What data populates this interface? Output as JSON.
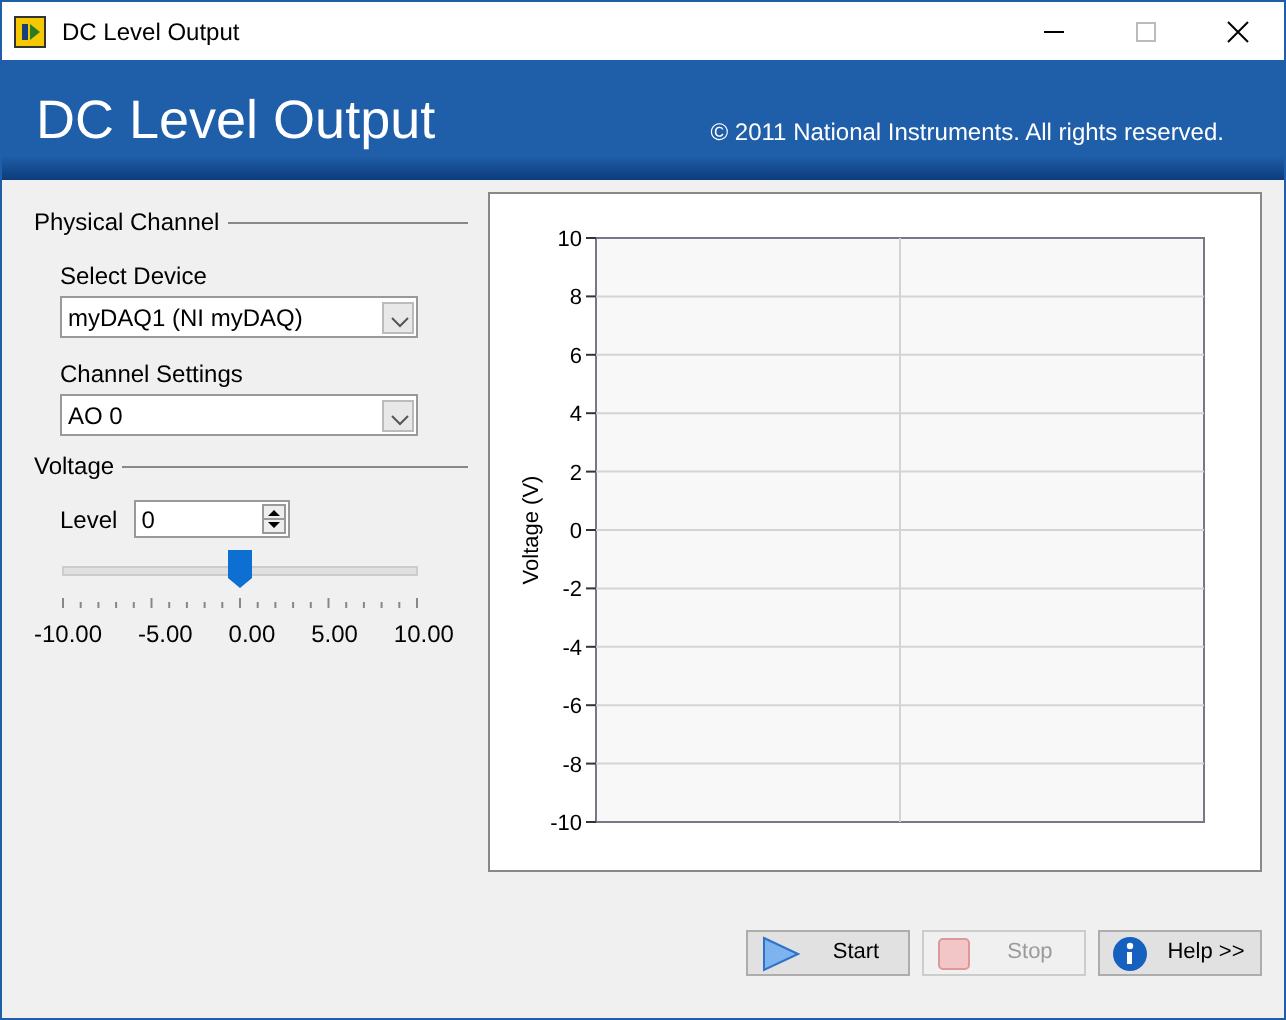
{
  "window": {
    "title": "DC Level Output"
  },
  "header": {
    "title": "DC Level Output",
    "copyright": "© 2011 National Instruments. All rights reserved."
  },
  "physical_channel": {
    "title": "Physical Channel",
    "fields": [
      {
        "label": "Select Device",
        "value": "myDAQ1 (NI myDAQ)"
      },
      {
        "label": "Channel Settings",
        "value": "AO 0"
      }
    ]
  },
  "voltage": {
    "title": "Voltage",
    "level_label": "Level",
    "level_value": "0",
    "level": 0.5,
    "scale_labels": [
      "-10.00",
      "-5.00",
      "0.00",
      "5.00",
      "10.00"
    ]
  },
  "chart": {
    "chart_data": {
      "type": "line",
      "categories": [
        null,
        null
      ],
      "values": [
        null,
        null
      ],
      "grid": true,
      "ylabel": "Voltage (V)",
      "ylim": [
        -10,
        10
      ],
      "yticks": [
        10,
        8,
        6,
        4,
        2,
        0,
        -2,
        -4,
        -6,
        -8,
        -10
      ]
    }
  },
  "buttons": [
    {
      "kind": "start",
      "label": "Start",
      "disabled": false
    },
    {
      "kind": "stop",
      "label": "Stop",
      "disabled": true
    },
    {
      "kind": "help",
      "label": "Help >>",
      "disabled": false
    }
  ]
}
